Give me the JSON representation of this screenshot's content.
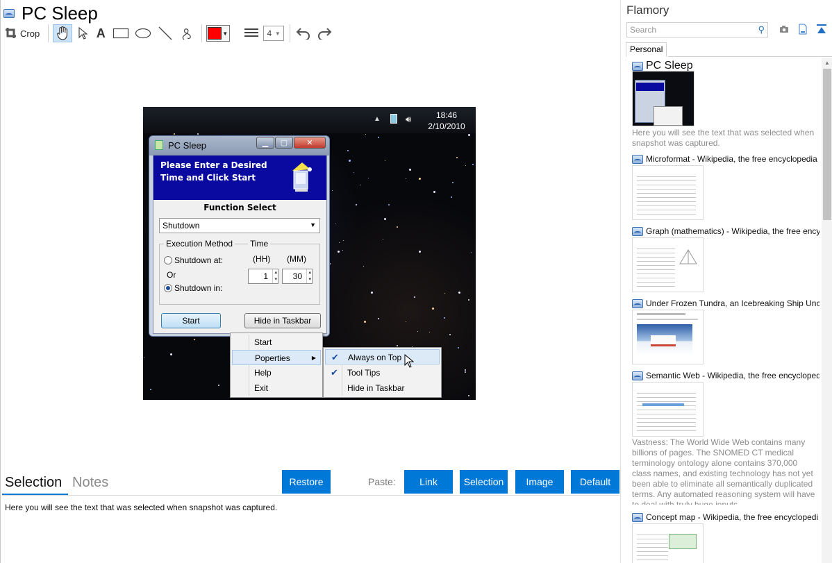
{
  "doc_title": "PC Sleep",
  "toolbar": {
    "crop_label": "Crop",
    "line_width": "4",
    "current_color": "#ff0000"
  },
  "screenshot": {
    "clock_time": "18:46",
    "clock_date": "2/10/2010",
    "window_title": "PC Sleep",
    "banner_line1": "Please Enter a Desired",
    "banner_line2": "Time and Click Start",
    "function_label": "Function Select",
    "function_value": "Shutdown",
    "exec_legend": "Execution Method",
    "time_legend": "Time",
    "shutdown_at_label": "Shutdown at:",
    "or_label": "Or",
    "shutdown_in_label": "Shutdown in:",
    "hh_label": "(HH)",
    "mm_label": "(MM)",
    "hh_value": "1",
    "mm_value": "30",
    "start_button": "Start",
    "hide_button": "Hide in Taskbar",
    "context_menu": [
      "Start",
      "Poperties",
      "Help",
      "Exit"
    ],
    "submenu": [
      "Always on Top",
      "Tool Tips",
      "Hide in Taskbar"
    ]
  },
  "bottom": {
    "tab_selection": "Selection",
    "tab_notes": "Notes",
    "restore": "Restore",
    "paste_label": "Paste:",
    "link": "Link",
    "selection": "Selection",
    "image": "Image",
    "default": "Default",
    "selection_text": "Here you will see the text that was selected when snapshot was captured."
  },
  "sidebar": {
    "app_name": "Flamory",
    "search_placeholder": "Search",
    "tab_personal": "Personal",
    "items": [
      {
        "title": "PC Sleep",
        "desc": "Here you will see the text that was selected when snapshot was captured."
      },
      {
        "title": "Microformat - Wikipedia, the free encyclopedia"
      },
      {
        "title": "Graph (mathematics) - Wikipedia, the free ency"
      },
      {
        "title": "Under Frozen Tundra, an Icebreaking Ship Unco"
      },
      {
        "title": "Semantic Web - Wikipedia, the free encycloped",
        "desc": "Vastness: The World Wide Web contains many billions of pages. The SNOMED CT medical terminology ontology alone contains 370,000 class names, and existing technology has not yet been able to eliminate all semantically duplicated terms. Any automated reasoning system will have to deal with truly huge inputs."
      },
      {
        "title": "Concept map - Wikipedia, the free encyclopedi"
      }
    ]
  }
}
